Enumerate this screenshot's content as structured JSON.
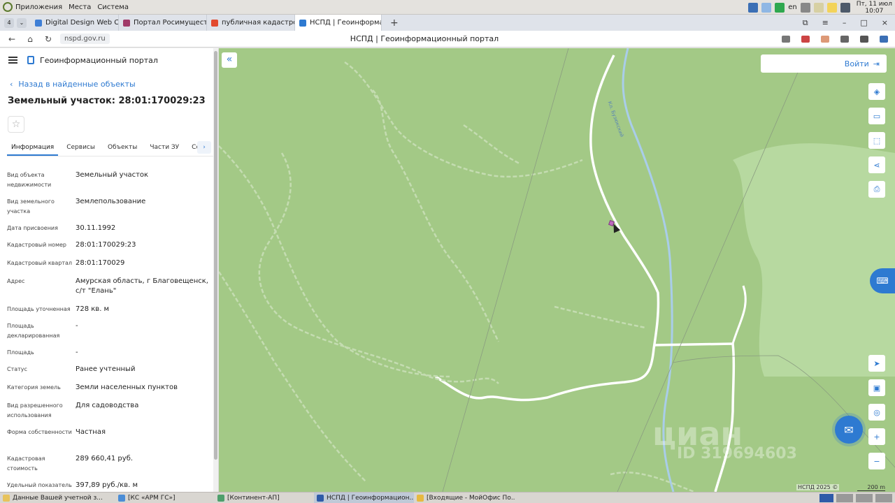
{
  "os_panel": {
    "menus": [
      "Приложения",
      "Места",
      "Система"
    ],
    "lang": "en",
    "clock_line1": "Пт, 11 июл",
    "clock_line2": "10:07"
  },
  "browser": {
    "tab_count": "4",
    "tabs": [
      {
        "title": "Digital Design Web Cli",
        "color": "#3f7fd6"
      },
      {
        "title": "Портал Росимущества",
        "color": "#a13b6a"
      },
      {
        "title": "публичная кадастров",
        "color": "#e24a2f"
      },
      {
        "title": "НСПД | Геоинформа",
        "color": "#2e7ad1",
        "active": true
      }
    ],
    "url": "nspd.gov.ru",
    "page_title": "НСПД | Геоинформационный портал"
  },
  "panel": {
    "portal_name": "Геоинформационный портал",
    "back_link": "Назад в найденные объекты",
    "object_title": "Земельный участок: 28:01:170029:23",
    "subtabs": [
      "Информация",
      "Сервисы",
      "Объекты",
      "Части ЗУ",
      "Соста"
    ],
    "attributes": [
      {
        "k": "Вид объекта недвижимости",
        "v": "Земельный участок"
      },
      {
        "k": "Вид земельного участка",
        "v": "Землепользование"
      },
      {
        "k": "Дата присвоения",
        "v": "30.11.1992"
      },
      {
        "k": "Кадастровый номер",
        "v": "28:01:170029:23"
      },
      {
        "k": "Кадастровый квартал",
        "v": "28:01:170029"
      },
      {
        "k": "Адрес",
        "v": "Амурская область, г Благовещенск, с/т \"Елань\""
      },
      {
        "k": "Площадь уточненная",
        "v": "728 кв. м"
      },
      {
        "k": "Площадь декларированная",
        "v": "-"
      },
      {
        "k": "Площадь",
        "v": "-"
      },
      {
        "k": "Статус",
        "v": "Ранее учтенный"
      },
      {
        "k": "Категория земель",
        "v": "Земли населенных пунктов"
      },
      {
        "k": "Вид разрешенного использования",
        "v": "Для садоводства"
      },
      {
        "k": "Форма собственности",
        "v": "Частная"
      },
      {
        "k": "Кадастровая стоимость",
        "v": "289 660,41 руб."
      },
      {
        "k": "Удельный показатель",
        "v": "397,89 руб./кв. м"
      }
    ]
  },
  "map": {
    "login_label": "Войти",
    "stream_label": "Кл. Бузюкский",
    "watermark": "циан",
    "watermark_id": "ID 319694603",
    "copyright": "НСПД 2025 ©",
    "scale_label": "200 m",
    "colors": {
      "land": "#a3c986",
      "forest_light": "#b7d9a0",
      "road": "#ffffff",
      "water": "#a9cdea",
      "accent": "#2e7ad1"
    }
  },
  "taskbar": {
    "items": [
      {
        "label": "Данные Вашей учетной з...",
        "color": "#e8c35c"
      },
      {
        "label": "[КС «АРМ ГС»]",
        "color": "#4b8dd6"
      },
      {
        "label": "[Континент-АП]",
        "color": "#4e9f6c"
      },
      {
        "label": "НСПД | Геоинформацион...",
        "color": "#2e5aa8",
        "active": true
      },
      {
        "label": "[Входящие - МойОфис По...",
        "color": "#e7b940"
      }
    ]
  }
}
